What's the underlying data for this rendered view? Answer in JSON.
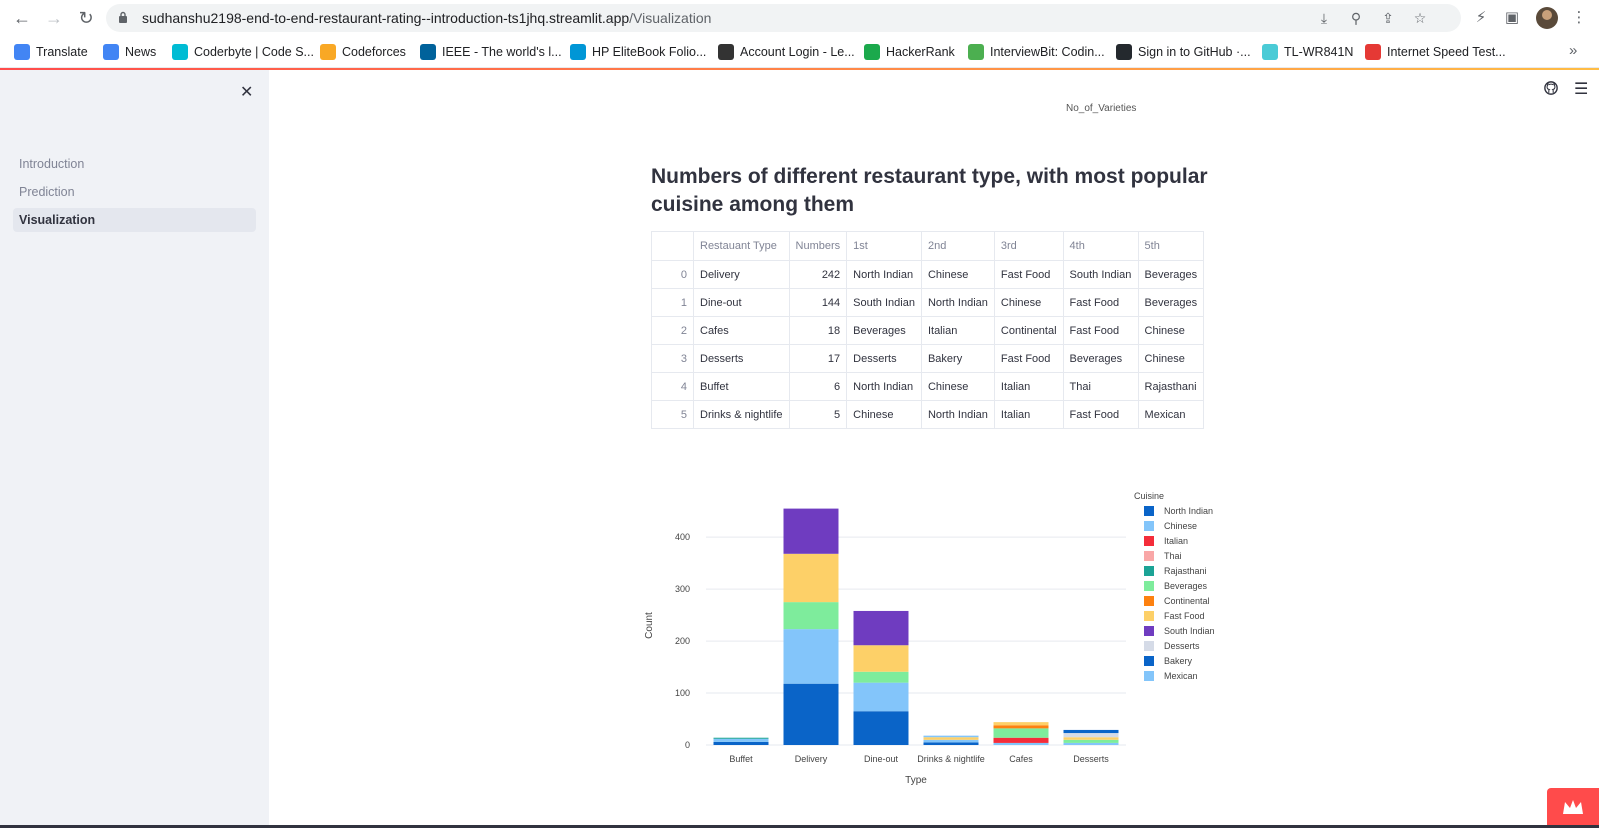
{
  "browser": {
    "url_domain": "sudhanshu2198-end-to-end-restaurant-rating--introduction-ts1jhq.streamlit.app",
    "url_path": "/Visualization",
    "bookmarks": [
      {
        "label": "Translate",
        "color": "#4285f4"
      },
      {
        "label": "News",
        "color": "#4285f4"
      },
      {
        "label": "Coderbyte | Code S...",
        "color": "#00bcd4"
      },
      {
        "label": "Codeforces",
        "color": "#f9a825"
      },
      {
        "label": "IEEE - The world's l...",
        "color": "#00629b"
      },
      {
        "label": "HP EliteBook Folio...",
        "color": "#0096d6"
      },
      {
        "label": "Account Login - Le...",
        "color": "#333333"
      },
      {
        "label": "HackerRank",
        "color": "#1ba94c"
      },
      {
        "label": "InterviewBit: Codin...",
        "color": "#4caf50"
      },
      {
        "label": "Sign in to GitHub ·...",
        "color": "#24292e"
      },
      {
        "label": "TL-WR841N",
        "color": "#4acbd6"
      },
      {
        "label": "Internet Speed Test...",
        "color": "#e53935"
      }
    ],
    "more_glyph": "»"
  },
  "sidebar": {
    "close_glyph": "✕",
    "items": [
      {
        "label": "Introduction"
      },
      {
        "label": "Prediction"
      },
      {
        "label": "Visualization"
      }
    ],
    "active_index": 2
  },
  "main": {
    "varieties_label": "No_of_Varieties",
    "title": "Numbers of different restaurant type, with most popular cuisine among them",
    "table": {
      "headers": [
        "",
        "Restauant Type",
        "Numbers",
        "1st",
        "2nd",
        "3rd",
        "4th",
        "5th"
      ],
      "rows": [
        [
          "0",
          "Delivery",
          "242",
          "North Indian",
          "Chinese",
          "Fast Food",
          "South Indian",
          "Beverages"
        ],
        [
          "1",
          "Dine-out",
          "144",
          "South Indian",
          "North Indian",
          "Chinese",
          "Fast Food",
          "Beverages"
        ],
        [
          "2",
          "Cafes",
          "18",
          "Beverages",
          "Italian",
          "Continental",
          "Fast Food",
          "Chinese"
        ],
        [
          "3",
          "Desserts",
          "17",
          "Desserts",
          "Bakery",
          "Fast Food",
          "Beverages",
          "Chinese"
        ],
        [
          "4",
          "Buffet",
          "6",
          "North Indian",
          "Chinese",
          "Italian",
          "Thai",
          "Rajasthani"
        ],
        [
          "5",
          "Drinks & nightlife",
          "5",
          "Chinese",
          "North Indian",
          "Italian",
          "Fast Food",
          "Mexican"
        ]
      ]
    }
  },
  "chart_data": {
    "type": "bar",
    "stacked": true,
    "xlabel": "Type",
    "ylabel": "Count",
    "ylim": [
      0,
      460
    ],
    "yticks": [
      0,
      100,
      200,
      300,
      400
    ],
    "grid": true,
    "legend_title": "Cuisine",
    "legend_position": "right",
    "categories": [
      "Buffet",
      "Delivery",
      "Dine-out",
      "Drinks & nightlife",
      "Cafes",
      "Desserts"
    ],
    "series": [
      {
        "name": "North Indian",
        "color": "#0a64c8",
        "values": [
          6,
          118,
          65,
          5,
          0,
          0
        ]
      },
      {
        "name": "Chinese",
        "color": "#83c5fa",
        "values": [
          6,
          105,
          55,
          5,
          4,
          4
        ]
      },
      {
        "name": "Italian",
        "color": "#f42d3a",
        "values": [
          0,
          0,
          0,
          0,
          10,
          0
        ]
      },
      {
        "name": "Thai",
        "color": "#f9a7a7",
        "values": [
          0,
          0,
          0,
          0,
          0,
          0
        ]
      },
      {
        "name": "Rajasthani",
        "color": "#1ca396",
        "values": [
          2,
          0,
          0,
          0,
          0,
          0
        ]
      },
      {
        "name": "Beverages",
        "color": "#7eec9c",
        "values": [
          0,
          52,
          21,
          0,
          18,
          6
        ]
      },
      {
        "name": "Continental",
        "color": "#fd8110",
        "values": [
          0,
          0,
          0,
          0,
          6,
          0
        ]
      },
      {
        "name": "Fast Food",
        "color": "#fdd068",
        "values": [
          0,
          93,
          51,
          5,
          6,
          5
        ]
      },
      {
        "name": "South Indian",
        "color": "#6f3cc0",
        "values": [
          0,
          87,
          66,
          0,
          0,
          0
        ]
      },
      {
        "name": "Desserts",
        "color": "#d5dbe7",
        "values": [
          0,
          0,
          0,
          0,
          0,
          8
        ]
      },
      {
        "name": "Bakery",
        "color": "#0a64c8",
        "values": [
          0,
          0,
          0,
          0,
          0,
          6
        ]
      },
      {
        "name": "Mexican",
        "color": "#83c5fa",
        "values": [
          0,
          0,
          0,
          3,
          0,
          0
        ]
      }
    ]
  }
}
